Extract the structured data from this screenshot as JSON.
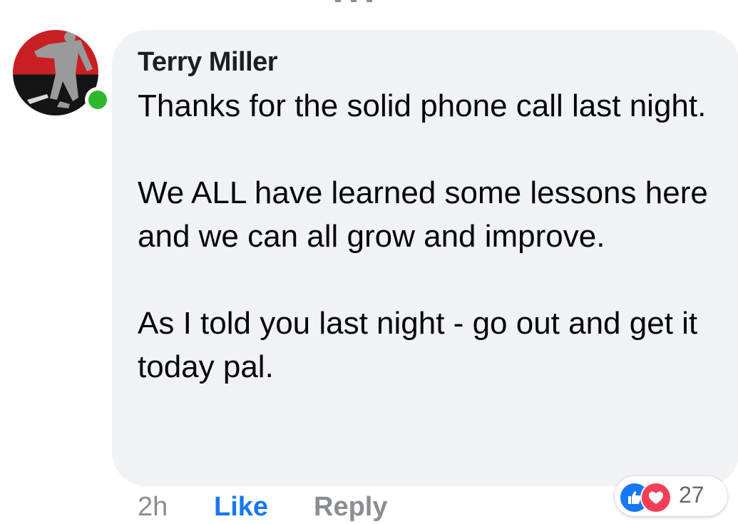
{
  "comment": {
    "author": "Terry Miller",
    "paragraphs": [
      "Thanks for the solid phone call last night.",
      "We ALL have learned some lessons here and we can all grow and improve.",
      "As I told you last night - go out and get it today pal."
    ],
    "timestamp": "2h",
    "like_label": "Like",
    "reply_label": "Reply",
    "reaction_count": "27",
    "reaction_icons": [
      "like-icon",
      "love-icon"
    ],
    "online": true
  },
  "colors": {
    "bubble": "#f0f2f5",
    "like_blue": "#1877f2",
    "love_red": "#f33e58",
    "online_green": "#2eb82e",
    "meta_gray": "#8a8d91"
  }
}
